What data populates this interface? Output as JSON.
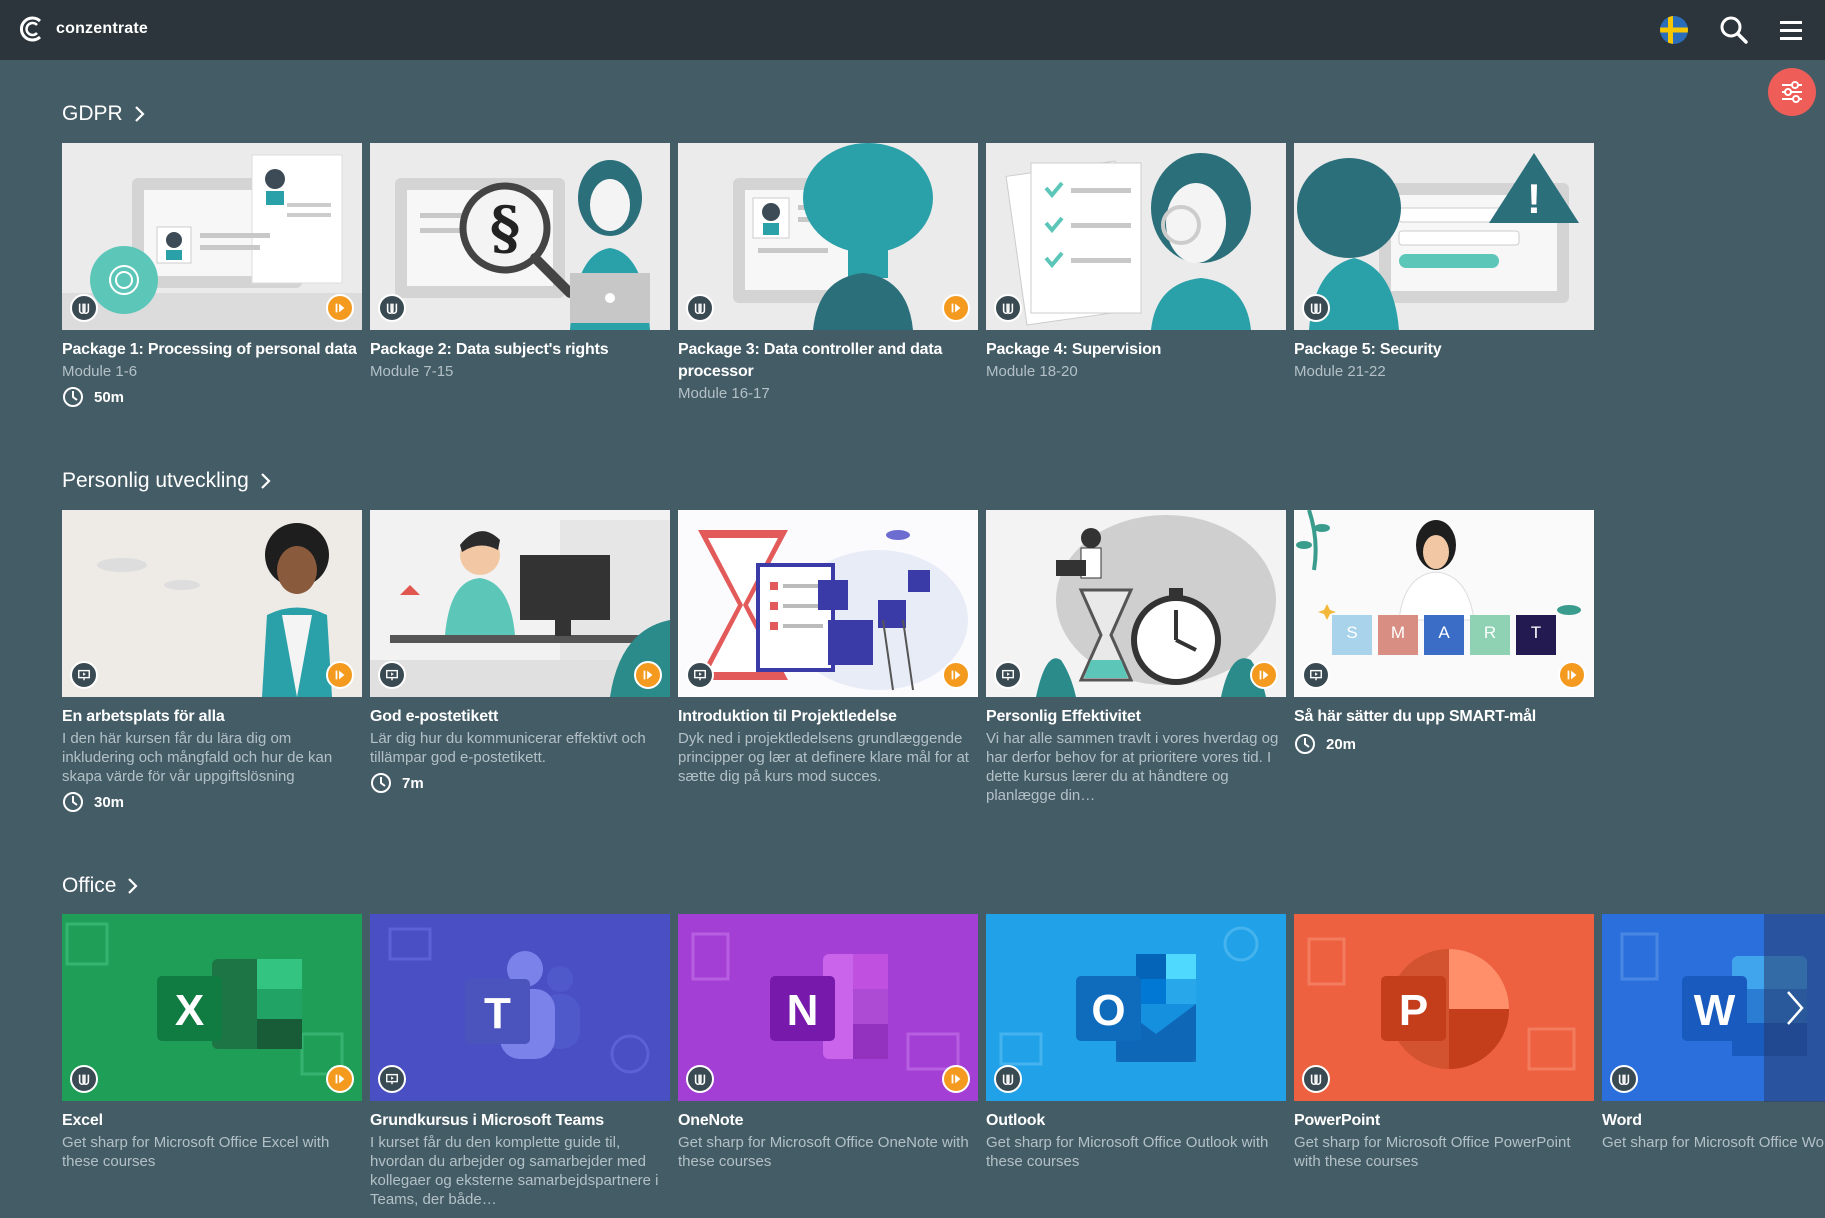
{
  "app": {
    "name": "conzentrate"
  },
  "colors": {
    "topbar": "#2b353b",
    "background": "#445c66",
    "accent": "#ee5d58",
    "play": "#f39a1f"
  },
  "icons": {
    "search": "search-icon",
    "menu": "hamburger-menu-icon",
    "filter": "filter-sliders-icon",
    "language": "sweden-flag-icon"
  },
  "sections": [
    {
      "title": "GDPR",
      "cards": [
        {
          "title": "Package 1: Processing of personal data",
          "sub": "Module 1-6",
          "duration": "50m"
        },
        {
          "title": "Package 2: Data subject's rights",
          "sub": "Module 7-15"
        },
        {
          "title": "Package 3: Data controller and data processor",
          "sub": "Module 16-17"
        },
        {
          "title": "Package 4: Supervision",
          "sub": "Module 18-20"
        },
        {
          "title": "Package 5: Security",
          "sub": "Module 21-22"
        }
      ]
    },
    {
      "title": "Personlig utveckling",
      "cards": [
        {
          "title": "En arbetsplats för alla",
          "sub": "I den här kursen får du lära dig om inkludering och mångfald och hur de kan skapa värde för vår uppgiftslösning",
          "duration": "30m"
        },
        {
          "title": "God e-postetikett",
          "sub": "Lär dig hur du kommunicerar effektivt och tillämpar god e-postetikett.",
          "duration": "7m"
        },
        {
          "title": "Introduktion til Projektledelse",
          "sub": "Dyk ned i projektledelsens grundlæggende principper og lær at definere klare mål for at sætte dig på kurs mod succes."
        },
        {
          "title": "Personlig Effektivitet",
          "sub": "Vi har alle sammen travlt i vores hverdag og har derfor behov for at prioritere vores tid. I dette kursus lærer du at håndtere og planlægge din…"
        },
        {
          "title": "Så här sätter du upp SMART-mål",
          "sub": "",
          "duration": "20m",
          "smart_letters": [
            "S",
            "M",
            "A",
            "R",
            "T"
          ]
        }
      ]
    },
    {
      "title": "Office",
      "cards": [
        {
          "title": "Excel",
          "sub": "Get sharp for Microsoft Office Excel with these courses",
          "letter": "X"
        },
        {
          "title": "Grundkursus i Microsoft Teams",
          "sub": "I kurset får du den komplette guide til, hvordan du arbejder og samarbejder med kollegaer og eksterne samarbejdspartnere i Teams, der både…",
          "letter": "T"
        },
        {
          "title": "OneNote",
          "sub": "Get sharp for Microsoft Office OneNote with these courses",
          "letter": "N"
        },
        {
          "title": "Outlook",
          "sub": "Get sharp for Microsoft Office Outlook with these courses",
          "letter": "O"
        },
        {
          "title": "PowerPoint",
          "sub": "Get sharp for Microsoft Office PowerPoint with these courses",
          "letter": "P"
        },
        {
          "title": "Word",
          "sub": "Get sharp for Microsoft Office Word with these courses",
          "letter": "W"
        }
      ]
    }
  ]
}
